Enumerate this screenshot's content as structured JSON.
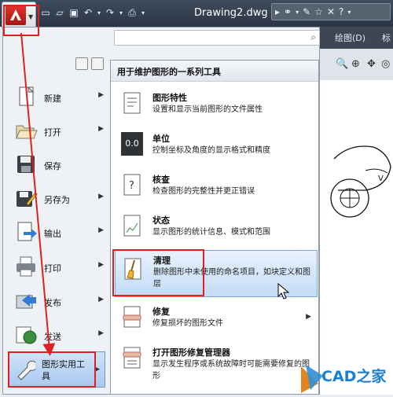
{
  "window": {
    "document_title": "Drawing2.dwg"
  },
  "quick_access": {
    "icons": [
      "new-icon",
      "open-icon",
      "save-icon",
      "undo-icon",
      "redo-icon",
      "plot-icon"
    ]
  },
  "help_bar": {
    "icons": [
      "binoculars-icon",
      "wrench-icon",
      "star-icon",
      "help-icon"
    ]
  },
  "ribbon": {
    "tab_draw": "绘图(D)",
    "tab_partial": "标"
  },
  "app_menu": {
    "search_placeholder": "",
    "items": [
      {
        "label": "新建",
        "icon": "new-document-icon",
        "has_submenu": true
      },
      {
        "label": "打开",
        "icon": "open-folder-icon",
        "has_submenu": true
      },
      {
        "label": "保存",
        "icon": "save-disk-icon",
        "has_submenu": false
      },
      {
        "label": "另存为",
        "icon": "save-as-icon",
        "has_submenu": true
      },
      {
        "label": "输出",
        "icon": "export-icon",
        "has_submenu": true
      },
      {
        "label": "打印",
        "icon": "print-icon",
        "has_submenu": true
      },
      {
        "label": "发布",
        "icon": "publish-icon",
        "has_submenu": true
      },
      {
        "label": "发送",
        "icon": "send-globe-icon",
        "has_submenu": true
      },
      {
        "label": "图形实用工具",
        "icon": "wrench-tools-icon",
        "has_submenu": true,
        "selected": true
      }
    ]
  },
  "submenu": {
    "header": "用于维护图形的一系列工具",
    "items": [
      {
        "title": "图形特性",
        "desc": "设置和显示当前图形的文件属性"
      },
      {
        "title": "单位",
        "desc": "控制坐标及角度的显示格式和精度",
        "icon_text": "0.0"
      },
      {
        "title": "核查",
        "desc": "检查图形的完整性并更正错误"
      },
      {
        "title": "状态",
        "desc": "显示图形的统计信息、模式和范围"
      },
      {
        "title": "清理",
        "desc": "删除图形中未使用的命名项目，如块定义和图层",
        "highlighted": true
      },
      {
        "title": "修复",
        "desc": "修复损坏的图形文件",
        "has_submenu": true
      },
      {
        "title": "打开图形修复管理器",
        "desc": "显示发生程序或系统故障时可能需要修复的图形"
      }
    ]
  },
  "watermark": {
    "text": "CAD之家"
  },
  "colors": {
    "accent_red": "#e02020",
    "highlight_blue": "#c3dbf6"
  }
}
